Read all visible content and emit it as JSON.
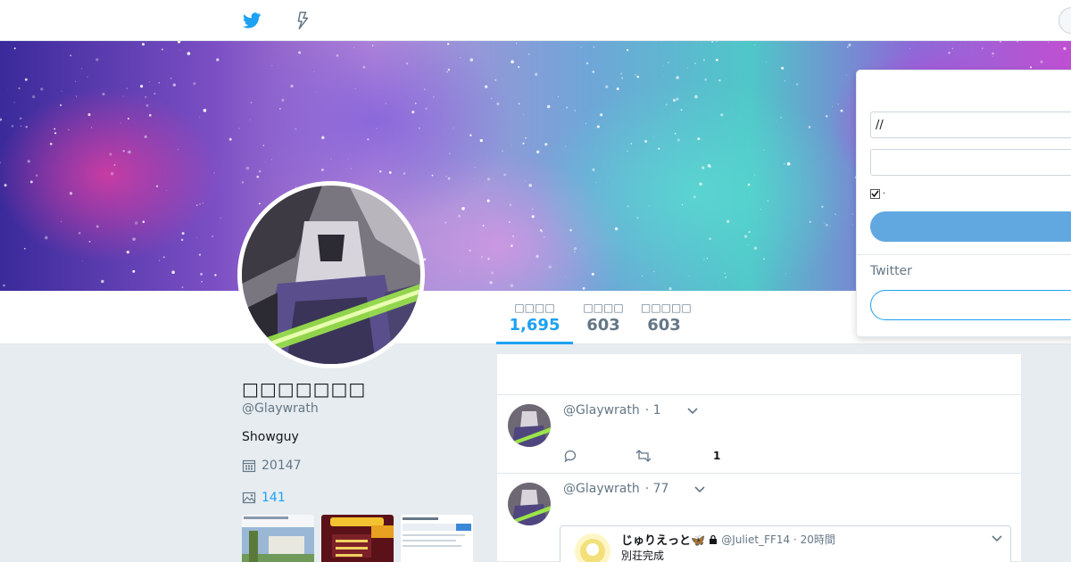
{
  "topbar": {
    "logo_icon": "twitter-bird-icon",
    "moments_icon": "lightning-bolt-icon"
  },
  "profile": {
    "name": "□□□□□□□",
    "handle": "@Glaywrath",
    "bio": "Showguy",
    "joined": "20147",
    "photos_count": "141"
  },
  "nav": {
    "stats": [
      {
        "label": "□□□□",
        "value": "1,695"
      },
      {
        "label": "□□□□",
        "value": "603"
      },
      {
        "label": "□□□□□",
        "value": "603"
      }
    ]
  },
  "tweets": [
    {
      "handle": "@Glaywrath",
      "time": "· 1",
      "like_count": "1"
    },
    {
      "handle": "@Glaywrath",
      "time": "· 77",
      "quote": {
        "name": "じゅりえっと🦋",
        "meta": "@Juliet_FF14 · 20時間",
        "text": "別荘完成"
      }
    }
  ],
  "login": {
    "username_value": "//",
    "password_value": "",
    "remember_label": "·",
    "signup_prompt": "Twitter"
  },
  "colors": {
    "accent": "#1da1f2",
    "login_button": "#61a8e0",
    "background": "#e6ecf0"
  }
}
